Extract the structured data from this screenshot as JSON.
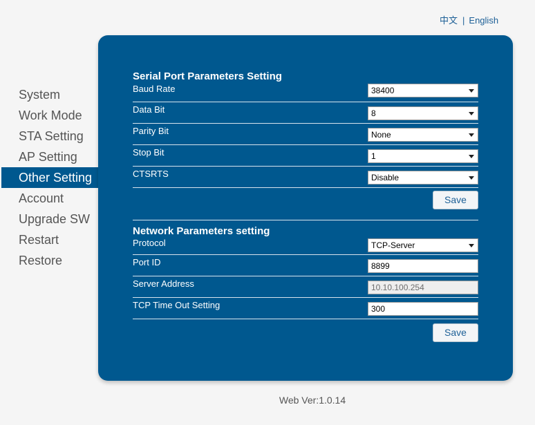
{
  "language": {
    "chinese": "中文",
    "separator": "|",
    "english": "English"
  },
  "sidebar": {
    "items": [
      {
        "label": "System"
      },
      {
        "label": "Work Mode"
      },
      {
        "label": "STA Setting"
      },
      {
        "label": "AP Setting"
      },
      {
        "label": "Other Setting"
      },
      {
        "label": "Account"
      },
      {
        "label": "Upgrade SW"
      },
      {
        "label": "Restart"
      },
      {
        "label": "Restore"
      }
    ],
    "active": "Other Setting"
  },
  "serial": {
    "title": "Serial Port Parameters Setting",
    "baud_rate": {
      "label": "Baud Rate",
      "value": "38400"
    },
    "data_bit": {
      "label": "Data Bit",
      "value": "8"
    },
    "parity_bit": {
      "label": "Parity Bit",
      "value": "None"
    },
    "stop_bit": {
      "label": "Stop Bit",
      "value": "1"
    },
    "ctsrts": {
      "label": "CTSRTS",
      "value": "Disable"
    },
    "save_label": "Save"
  },
  "network": {
    "title": "Network Parameters setting",
    "protocol": {
      "label": "Protocol",
      "value": "TCP-Server"
    },
    "port_id": {
      "label": "Port ID",
      "value": "8899"
    },
    "server_address": {
      "label": "Server Address",
      "value": "10.10.100.254"
    },
    "tcp_timeout": {
      "label": "TCP Time Out Setting",
      "value": "300"
    },
    "save_label": "Save"
  },
  "footer": {
    "version": "Web Ver:1.0.14"
  },
  "colors": {
    "panel": "#00588f",
    "active_nav": "#00588f",
    "link": "#1c5f96"
  }
}
